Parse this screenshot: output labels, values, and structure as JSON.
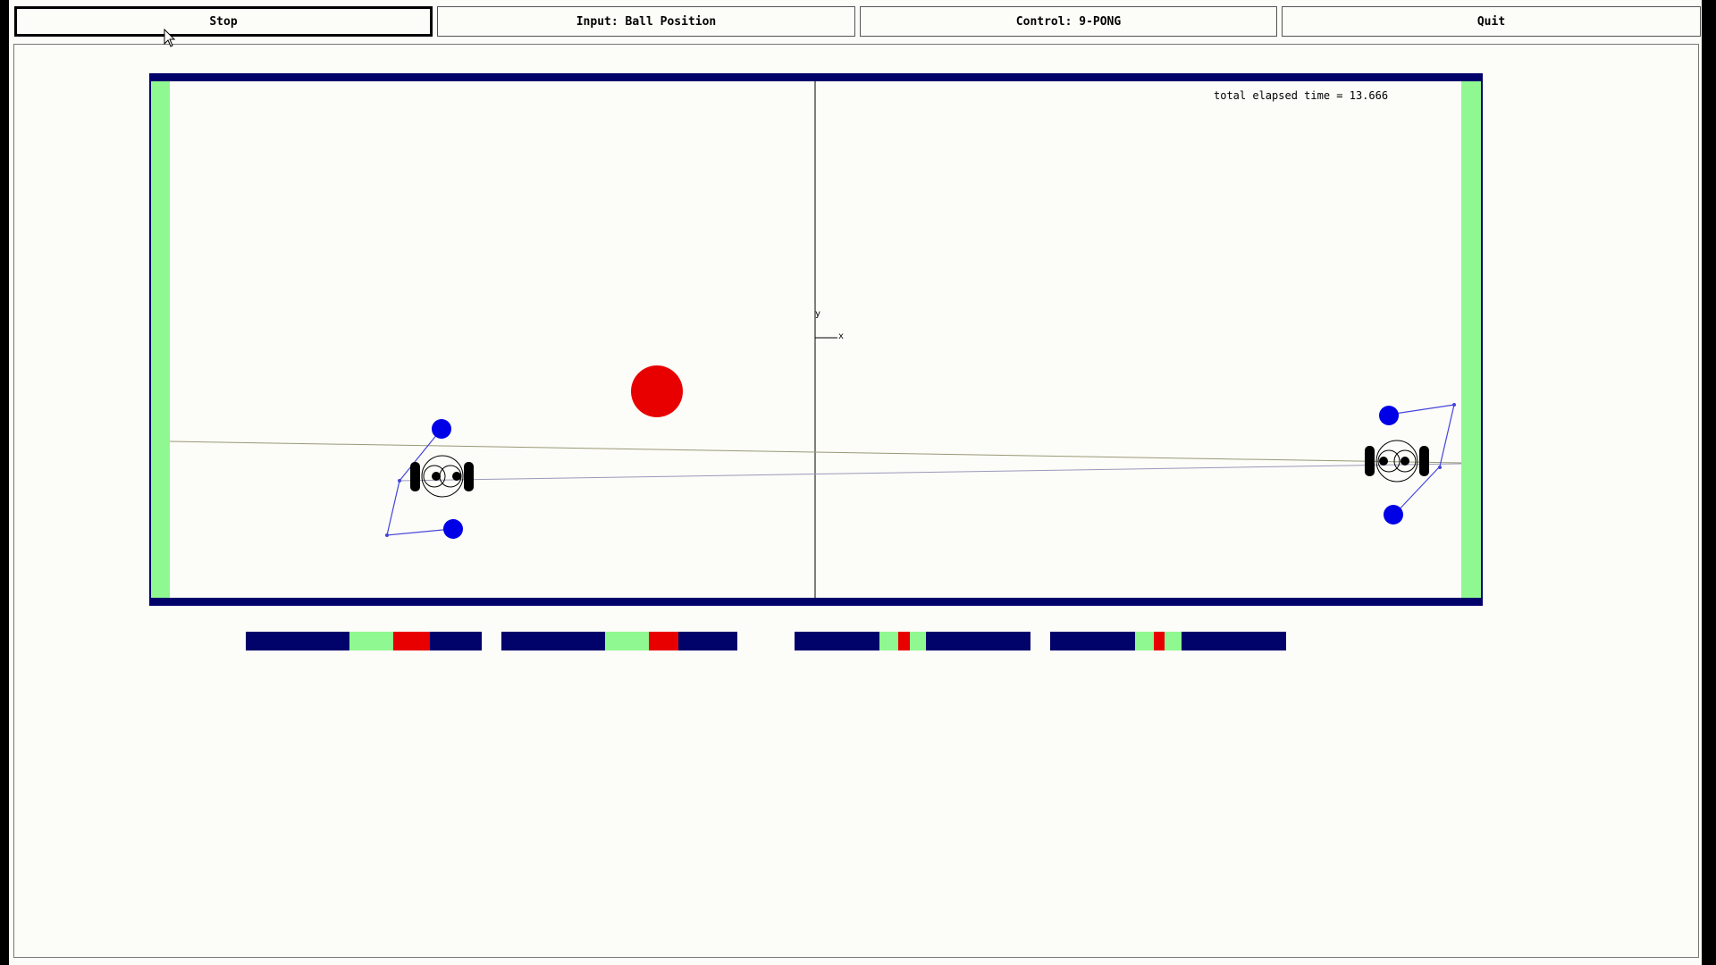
{
  "toolbar": {
    "stop_label": "Stop",
    "input_label": "Input: Ball Position",
    "control_label": "Control: 9-PONG",
    "quit_label": "Quit"
  },
  "field": {
    "elapsed_text": "total elapsed time = 13.666",
    "axis_y_label": "y",
    "axis_x_label": "x"
  },
  "gauges": [
    {
      "green_start": 0.44,
      "red_start": 0.625,
      "red_end": 0.78
    },
    {
      "green_start": 0.44,
      "red_start": 0.625,
      "red_end": 0.75
    },
    {
      "green_start": 0.36,
      "red_start": 0.44,
      "red_end": 0.49,
      "green_end": 0.555
    },
    {
      "green_start": 0.36,
      "red_start": 0.44,
      "red_end": 0.485,
      "green_end": 0.555
    }
  ],
  "colors": {
    "navy": "#02026b",
    "goal_green": "#90f890",
    "ball_red": "#e80000",
    "marker_blue": "#0000e6",
    "field_bg": "#fcfcf8"
  },
  "icons": [
    "mouse-pointer-icon"
  ]
}
